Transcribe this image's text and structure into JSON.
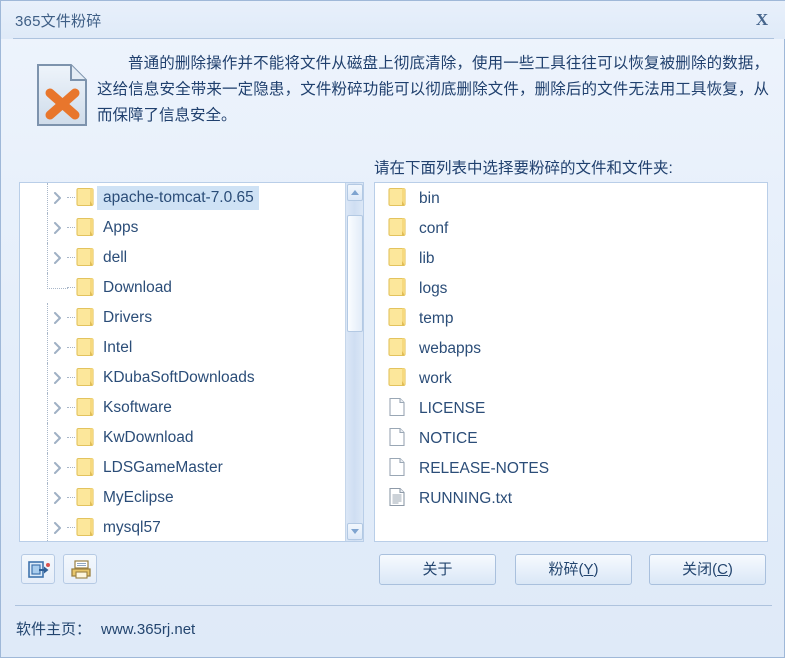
{
  "window": {
    "title": "365文件粉碎",
    "close_label": "X"
  },
  "intro": {
    "icon": "shredded-file-icon",
    "text": "普通的删除操作并不能将文件从磁盘上彻底清除，使用一些工具往往可以恢复被删除的数据，这给信息安全带来一定隐患，文件粉碎功能可以彻底删除文件，删除后的文件无法用工具恢复，从而保障了信息安全。"
  },
  "list_caption": "请在下面列表中选择要粉碎的文件和文件夹:",
  "tree": {
    "items": [
      {
        "label": "apache-tomcat-7.0.65",
        "icon": "folder-icon",
        "expandable": true,
        "selected": true
      },
      {
        "label": "Apps",
        "icon": "folder-icon",
        "expandable": true,
        "selected": false
      },
      {
        "label": "dell",
        "icon": "folder-icon",
        "expandable": true,
        "selected": false
      },
      {
        "label": "Download",
        "icon": "folder-icon",
        "expandable": false,
        "selected": false
      },
      {
        "label": "Drivers",
        "icon": "folder-icon",
        "expandable": true,
        "selected": false
      },
      {
        "label": "Intel",
        "icon": "folder-icon",
        "expandable": true,
        "selected": false
      },
      {
        "label": "KDubaSoftDownloads",
        "icon": "folder-icon",
        "expandable": true,
        "selected": false
      },
      {
        "label": "Ksoftware",
        "icon": "folder-icon",
        "expandable": true,
        "selected": false
      },
      {
        "label": "KwDownload",
        "icon": "folder-icon",
        "expandable": true,
        "selected": false
      },
      {
        "label": "LDSGameMaster",
        "icon": "folder-icon",
        "expandable": true,
        "selected": false
      },
      {
        "label": "MyEclipse",
        "icon": "folder-icon",
        "expandable": true,
        "selected": false
      },
      {
        "label": "mysql57",
        "icon": "folder-icon",
        "expandable": true,
        "selected": false
      }
    ],
    "scrollbar": {
      "up": "scroll-up-arrow",
      "down": "scroll-down-arrow"
    }
  },
  "files": {
    "items": [
      {
        "label": "bin",
        "icon": "folder-icon"
      },
      {
        "label": "conf",
        "icon": "folder-icon"
      },
      {
        "label": "lib",
        "icon": "folder-icon"
      },
      {
        "label": "logs",
        "icon": "folder-icon"
      },
      {
        "label": "temp",
        "icon": "folder-icon"
      },
      {
        "label": "webapps",
        "icon": "folder-icon"
      },
      {
        "label": "work",
        "icon": "folder-icon"
      },
      {
        "label": "LICENSE",
        "icon": "file-icon"
      },
      {
        "label": "NOTICE",
        "icon": "file-icon"
      },
      {
        "label": "RELEASE-NOTES",
        "icon": "file-icon"
      },
      {
        "label": "RUNNING.txt",
        "icon": "text-file-icon"
      }
    ]
  },
  "toolbar": {
    "add_button_icon": "open-folder-arrow-icon",
    "print_button_icon": "printer-icon"
  },
  "actions": {
    "about": {
      "label": "关于",
      "mnemonic": ""
    },
    "shred": {
      "label": "粉碎(",
      "mnemonic": "Y",
      "suffix": ")"
    },
    "close": {
      "label": "关闭(",
      "mnemonic": "C",
      "suffix": ")"
    }
  },
  "footer": {
    "label": "软件主页：",
    "url": "www.365rj.net"
  },
  "colors": {
    "accent": "#2b4d78",
    "folder": "#fbe38d",
    "selection": "#cfe2f5",
    "panel_border": "#b9cee8"
  }
}
